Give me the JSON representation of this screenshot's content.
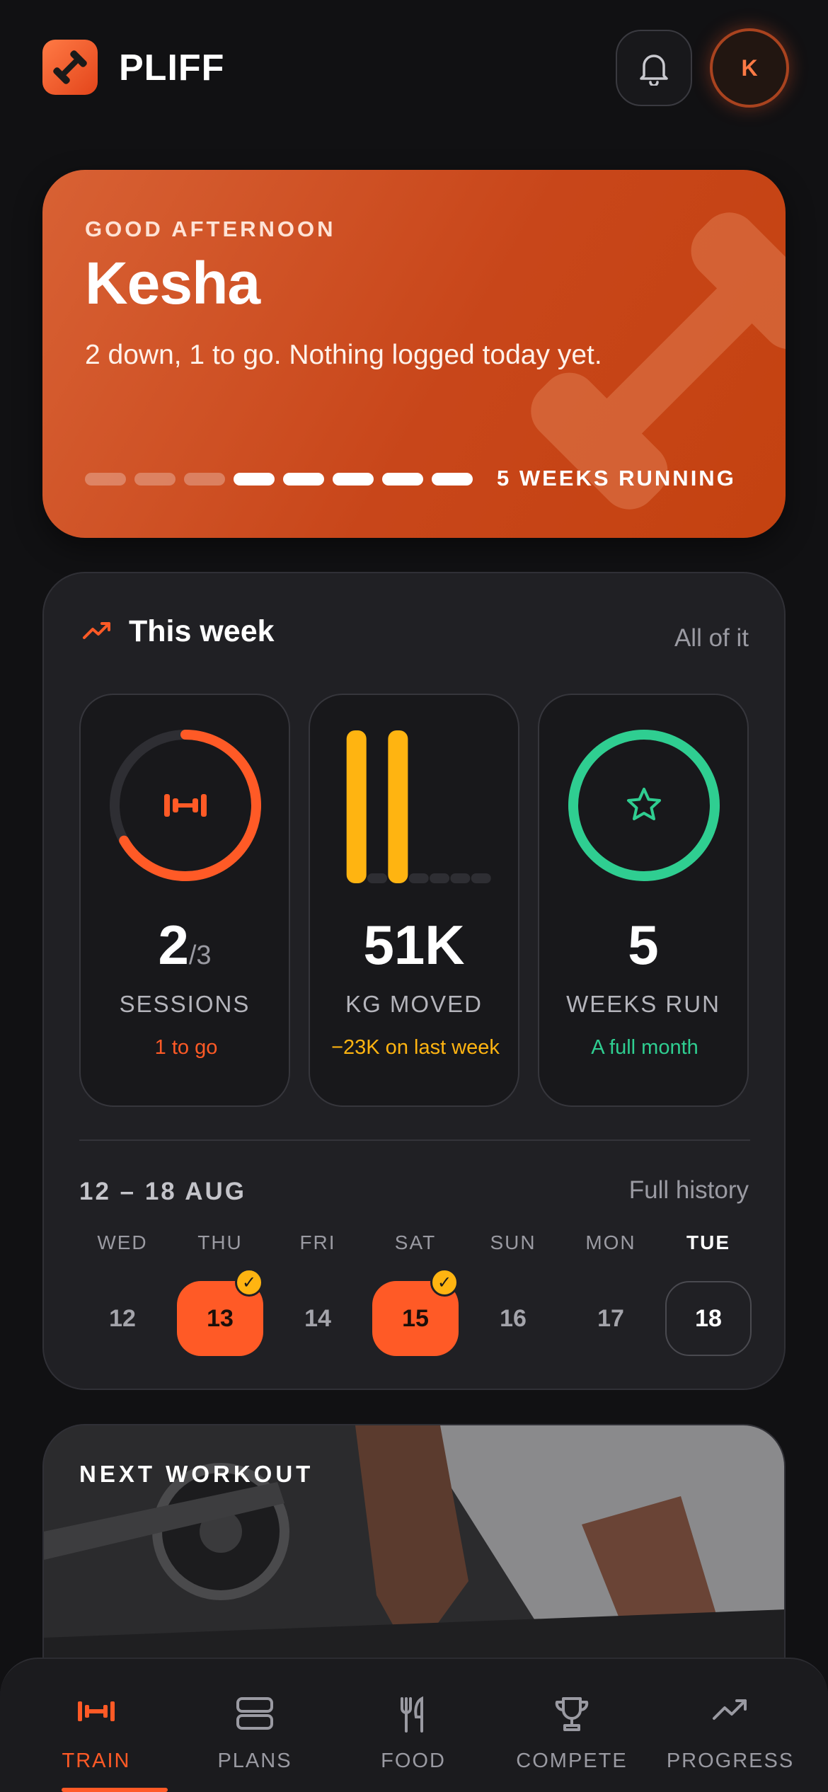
{
  "header": {
    "app_name": "PLIFF",
    "avatar_initial": "K",
    "logo_icon": "dumbbell-icon",
    "bell_icon": "bell-icon"
  },
  "hero": {
    "greeting": "GOOD AFTERNOON",
    "name": "Kesha",
    "subtitle": "2 down, 1 to go. Nothing logged today yet.",
    "streak_label": "5 WEEKS RUNNING",
    "streak_segments_total": 8,
    "streak_segments_active": 5
  },
  "week": {
    "title": "This week",
    "link": "All of it",
    "stats": [
      {
        "value": "2",
        "denominator": "/3",
        "label": "SESSIONS",
        "note": "1 to go",
        "progress": 0.667,
        "icon": "dumbbell-icon"
      },
      {
        "value": "51K",
        "label": "KG MOVED",
        "note": "−23K on last week",
        "bars": [
          1,
          0,
          1,
          0,
          0,
          0,
          0
        ]
      },
      {
        "value": "5",
        "label": "WEEKS RUN",
        "note": "A full month",
        "progress": 1.0,
        "icon": "star-icon"
      }
    ],
    "range": "12 – 18 AUG",
    "history_link": "Full history",
    "days": [
      {
        "name": "WED",
        "num": "12",
        "done": false,
        "today": false
      },
      {
        "name": "THU",
        "num": "13",
        "done": true,
        "today": false
      },
      {
        "name": "FRI",
        "num": "14",
        "done": false,
        "today": false
      },
      {
        "name": "SAT",
        "num": "15",
        "done": true,
        "today": false
      },
      {
        "name": "SUN",
        "num": "16",
        "done": false,
        "today": false
      },
      {
        "name": "MON",
        "num": "17",
        "done": false,
        "today": false
      },
      {
        "name": "TUE",
        "num": "18",
        "done": false,
        "today": true
      }
    ],
    "check_glyph": "✓"
  },
  "next_workout": {
    "label": "NEXT WORKOUT"
  },
  "nav": [
    {
      "label": "TRAIN",
      "icon": "dumbbell-icon",
      "active": true
    },
    {
      "label": "PLANS",
      "icon": "plans-icon",
      "active": false
    },
    {
      "label": "FOOD",
      "icon": "fork-knife-icon",
      "active": false
    },
    {
      "label": "COMPETE",
      "icon": "trophy-icon",
      "active": false
    },
    {
      "label": "PROGRESS",
      "icon": "trend-up-icon",
      "active": false
    }
  ],
  "colors": {
    "accent": "#ff5a26",
    "sessions": "#ff5a26",
    "kg": "#ffb411",
    "weeks": "#2fce91"
  }
}
